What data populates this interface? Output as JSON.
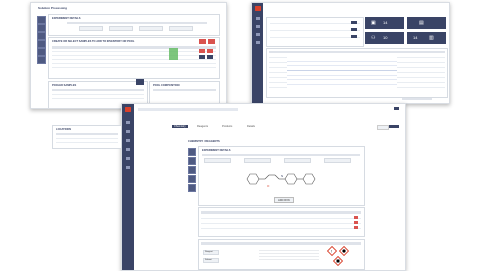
{
  "window1": {
    "title": "Solution Processing",
    "experiment_details": "EXPERIMENT DETAILS",
    "create_prompt": "CREATE OR SELECT SAMPLES TO ADD TO INVENTORY OR POOL",
    "pooled_samples": "POOLED SAMPLES",
    "pool_composition": "POOL COMPOSITION"
  },
  "window3": {
    "tabs": [
      "Chemistry",
      "Reagents",
      "Products",
      "Details"
    ],
    "active_tab": "Chemistry",
    "section_title": "CHEMISTRY / REAGENTS",
    "experiment_details": "EXPERIMENT DETAILS",
    "add_button": "ADD RXN",
    "locations": "LOCATIONS",
    "chip_labels": [
      "Reagent",
      "Solvent"
    ]
  },
  "window2": {
    "tile_values": [
      "14",
      "10",
      "14"
    ]
  },
  "colors": {
    "rail": "#3a4466",
    "accent": "#d9402b",
    "success": "#5cb85c",
    "danger": "#d9534f",
    "hazard": "#d9402b"
  },
  "icons": [
    "logo-icon",
    "flask-icon",
    "folder-icon",
    "list-icon",
    "users-icon",
    "book-icon",
    "hazard-icon",
    "chemical-structure-icon",
    "close-icon"
  ]
}
